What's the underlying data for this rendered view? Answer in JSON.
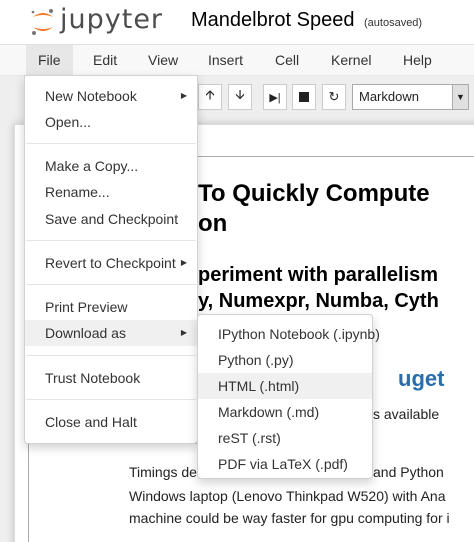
{
  "header": {
    "logo_text": "jupyter",
    "notebook_name": "Mandelbrot Speed",
    "autosave_status": "(autosaved)"
  },
  "menubar": {
    "items": [
      "File",
      "Edit",
      "View",
      "Insert",
      "Cell",
      "Kernel",
      "Help"
    ],
    "active": "File"
  },
  "toolbar": {
    "cell_type": "Markdown",
    "buttons": [
      "arrow-up-icon",
      "arrow-down-icon",
      "step-icon",
      "stop-icon",
      "restart-icon"
    ]
  },
  "file_menu": {
    "items": [
      {
        "label": "New Notebook",
        "submenu": true
      },
      {
        "label": "Open..."
      },
      {
        "label": "Make a Copy..."
      },
      {
        "label": "Rename..."
      },
      {
        "label": "Save and Checkpoint"
      },
      {
        "label": "Revert to Checkpoint",
        "submenu": true
      },
      {
        "label": "Print Preview"
      },
      {
        "label": "Download as",
        "submenu": true
      },
      {
        "label": "Trust Notebook"
      },
      {
        "label": "Close and Halt"
      }
    ]
  },
  "download_menu": {
    "items": [
      "IPython Notebook (.ipynb)",
      "Python (.py)",
      "HTML (.html)",
      "Markdown (.md)",
      "reST (.rst)",
      "PDF via LaTeX (.pdf)"
    ],
    "highlighted": "HTML (.html)"
  },
  "notebook": {
    "h1_line1": "To Quickly Compute",
    "h1_line2": "on",
    "h2_line1": "periment with parallelism",
    "h2_line2": "y, Numexpr, Numba, Cyth",
    "link_fragment": "uget",
    "available_fragment": "s available",
    "timings_fragment_a": "Timings de",
    "timings_fragment_b": "and Python",
    "line2": "Windows laptop (Lenovo Thinkpad W520) with Ana",
    "line3": "machine could be way faster for gpu computing for i"
  },
  "colors": {
    "accent_link": "#296eaa",
    "logo_orange": "#f37726",
    "menu_active_bg": "#e7e7e7",
    "highlight_bg": "#f0f0f0"
  }
}
